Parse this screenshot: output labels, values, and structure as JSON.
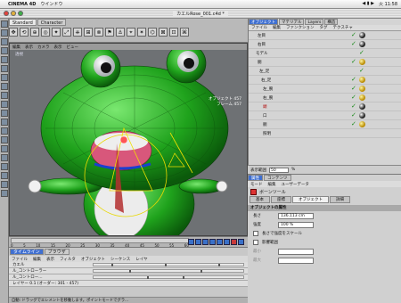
{
  "menubar": {
    "apple": "",
    "app": "CINEMA 4D",
    "window": "ウインドウ",
    "status_icons": "◀ ▮ ▶",
    "clock": "火 11:58"
  },
  "titlebar": {
    "title": "カエルRose_001.c4d *"
  },
  "toolbar": {
    "tabs": [
      "Standard",
      "Character"
    ],
    "tools": [
      "✥",
      "⟲",
      "⊕",
      "◎",
      "✦",
      "⤢",
      "⎈",
      "⊞",
      "⊗",
      "⚑",
      "⚓",
      "⌖",
      "✶",
      "⌬",
      "⊠",
      "⊡",
      "⌘"
    ]
  },
  "viewport": {
    "menu": [
      "編集",
      "表示",
      "カメラ",
      "表示",
      "ビュー"
    ],
    "label": "透視",
    "info_line1": "オブジェクト 457",
    "info_line2": "フレーム 457"
  },
  "timeline": {
    "ticks": [
      "0",
      "5",
      "10",
      "15",
      "20",
      "25",
      "30",
      "35",
      "40",
      "45",
      "50",
      "55",
      "60"
    ]
  },
  "bottom": {
    "tabs": [
      "タイムライン",
      "ブラウザ"
    ],
    "menu": [
      "ファイル",
      "編集",
      "表示",
      "フィルタ",
      "オブジェクト",
      "シーケンス",
      "レイヤ"
    ],
    "tracks": [
      "カエル",
      "ル_コントローラー",
      "ル_コントロー...",
      "レイヤー 0.1 (オーダー: 301 - 457)"
    ],
    "status": "自動: ドラッグでエレメントを移動します。ポイントモードでグラ..."
  },
  "objmgr": {
    "tabs": [
      "オブジェクト",
      "マテリアル",
      "Layers",
      "構造"
    ],
    "menu": [
      "ファイル",
      "編集",
      "ファンクション",
      "タグ",
      "テクスチャ"
    ],
    "rows": [
      {
        "name": "左目",
        "tags": [
          "chk",
          "ball"
        ]
      },
      {
        "name": "右目",
        "tags": [
          "chk",
          "ball"
        ]
      },
      {
        "name": "モデル",
        "tags": [
          "chk"
        ]
      },
      {
        "name": "胴",
        "tags": [
          "chk",
          "yel"
        ]
      },
      {
        "name": "左_足",
        "tags": [
          "chk"
        ]
      },
      {
        "name": "右_足",
        "tags": [
          "chk",
          "yel"
        ]
      },
      {
        "name": "左_腕",
        "tags": [
          "chk",
          "yel"
        ]
      },
      {
        "name": "右_腕",
        "tags": [
          "chk",
          "yel"
        ]
      },
      {
        "name": "頭",
        "tags": [
          "chk",
          "ball"
        ]
      },
      {
        "name": "口",
        "tags": [
          "chk",
          "ball"
        ]
      },
      {
        "name": "胴",
        "tags": [
          "chk",
          "yel"
        ]
      },
      {
        "name": "照明",
        "tags": []
      }
    ],
    "selected_index": 8
  },
  "layer": {
    "label": "表示範囲",
    "value": "50",
    "unit": "%"
  },
  "attrmgr": {
    "tabs": [
      "属性",
      "コンテンツ"
    ],
    "menu": [
      "モード",
      "編集",
      "ユーザーデータ"
    ],
    "object_name": "ボーンツール",
    "subtabs": [
      "基本",
      "座標",
      "オブジェクト",
      "詳細"
    ],
    "section": "オブジェクトの属性",
    "rows": [
      {
        "label": "長さ",
        "value": "136.113 cm",
        "kind": "field"
      },
      {
        "label": "強度",
        "value": "100 %",
        "kind": "field"
      },
      {
        "label": "長さで強度をスケール",
        "value": "",
        "kind": "check"
      },
      {
        "label": "影響範囲",
        "value": "",
        "kind": "check"
      },
      {
        "label": "最小",
        "value": "",
        "kind": "field-dim"
      },
      {
        "label": "最大",
        "value": "",
        "kind": "field-dim"
      }
    ]
  }
}
